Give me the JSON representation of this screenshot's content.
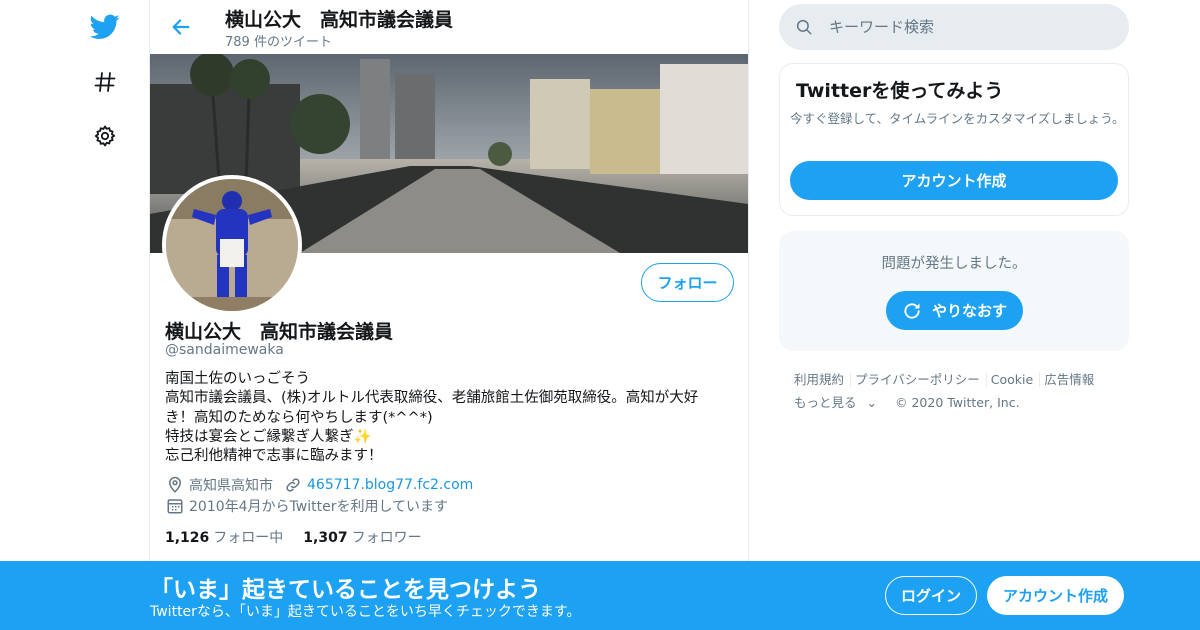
{
  "colors": {
    "accent": "#1da1f2",
    "secondary_text": "#657786",
    "link": "#1b95e0",
    "border": "#e6ecf0"
  },
  "nav": {
    "icons": [
      "twitter-bird-icon",
      "hashtag-icon",
      "gear-icon"
    ]
  },
  "header": {
    "name": "横山公大　高知市議会議員",
    "tweet_count": "789 件のツイート"
  },
  "profile": {
    "name": "横山公大　高知市議会議員",
    "handle": "@sandaimewaka",
    "follow_label": "フォロー",
    "bio": [
      "南国土佐のいっごそう",
      "高知市議会議員、(株)オルトル代表取締役、老舗旅館土佐御苑取締役。高知が大好",
      "き！高知のためなら何やちします(*^^*)",
      "特技は宴会とご縁繋ぎ人繋ぎ✨",
      "忘己利他精神で志事に臨みます！"
    ],
    "location": "高知県高知市",
    "website": "465717.blog77.fc2.com",
    "joined": "2010年4月からTwitterを利用しています",
    "following_count": "1,126",
    "following_label": "フォロー中",
    "followers_count": "1,307",
    "followers_label": "フォロワー"
  },
  "search": {
    "placeholder": "キーワード検索"
  },
  "signup_card": {
    "title": "Twitterを使ってみよう",
    "description": "今すぐ登録して、タイムラインをカスタマイズしましょう。",
    "button": "アカウント作成"
  },
  "error_card": {
    "message": "問題が発生しました。",
    "retry": "やりなおす"
  },
  "footer": {
    "links": [
      "利用規約",
      "プライバシーポリシー",
      "Cookie",
      "広告情報",
      "もっと見る"
    ],
    "copyright": "© 2020 Twitter, Inc."
  },
  "bottom_bar": {
    "headline": "「いま」起きていることを見つけよう",
    "subtext": "Twitterなら、「いま」起きていることをいち早くチェックできます。",
    "login": "ログイン",
    "signup": "アカウント作成"
  }
}
